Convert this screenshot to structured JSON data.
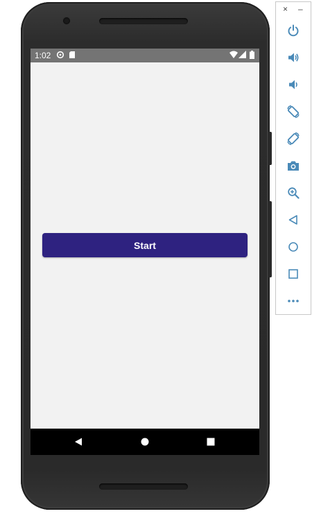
{
  "status_bar": {
    "time": "1:02",
    "icons": [
      "sync-icon",
      "sd-card-icon",
      "wifi-icon",
      "signal-icon",
      "battery-icon"
    ]
  },
  "main": {
    "start_button_label": "Start"
  },
  "nav_bar": {
    "buttons": [
      "back-icon",
      "home-icon",
      "overview-icon"
    ]
  },
  "emulator_toolbar": {
    "window_controls": [
      "close-icon",
      "minimize-icon"
    ],
    "close_glyph": "×",
    "minimize_glyph": "–",
    "buttons": [
      "power-icon",
      "volume-up-icon",
      "volume-down-icon",
      "rotate-left-icon",
      "rotate-right-icon",
      "screenshot-icon",
      "zoom-icon",
      "back-icon",
      "home-icon",
      "overview-icon",
      "more-icon"
    ]
  },
  "colors": {
    "accent_button": "#2e2280",
    "screen_background": "#f2f2f2",
    "status_bar": "#747474",
    "toolbar_icon": "#4a8ab8"
  }
}
